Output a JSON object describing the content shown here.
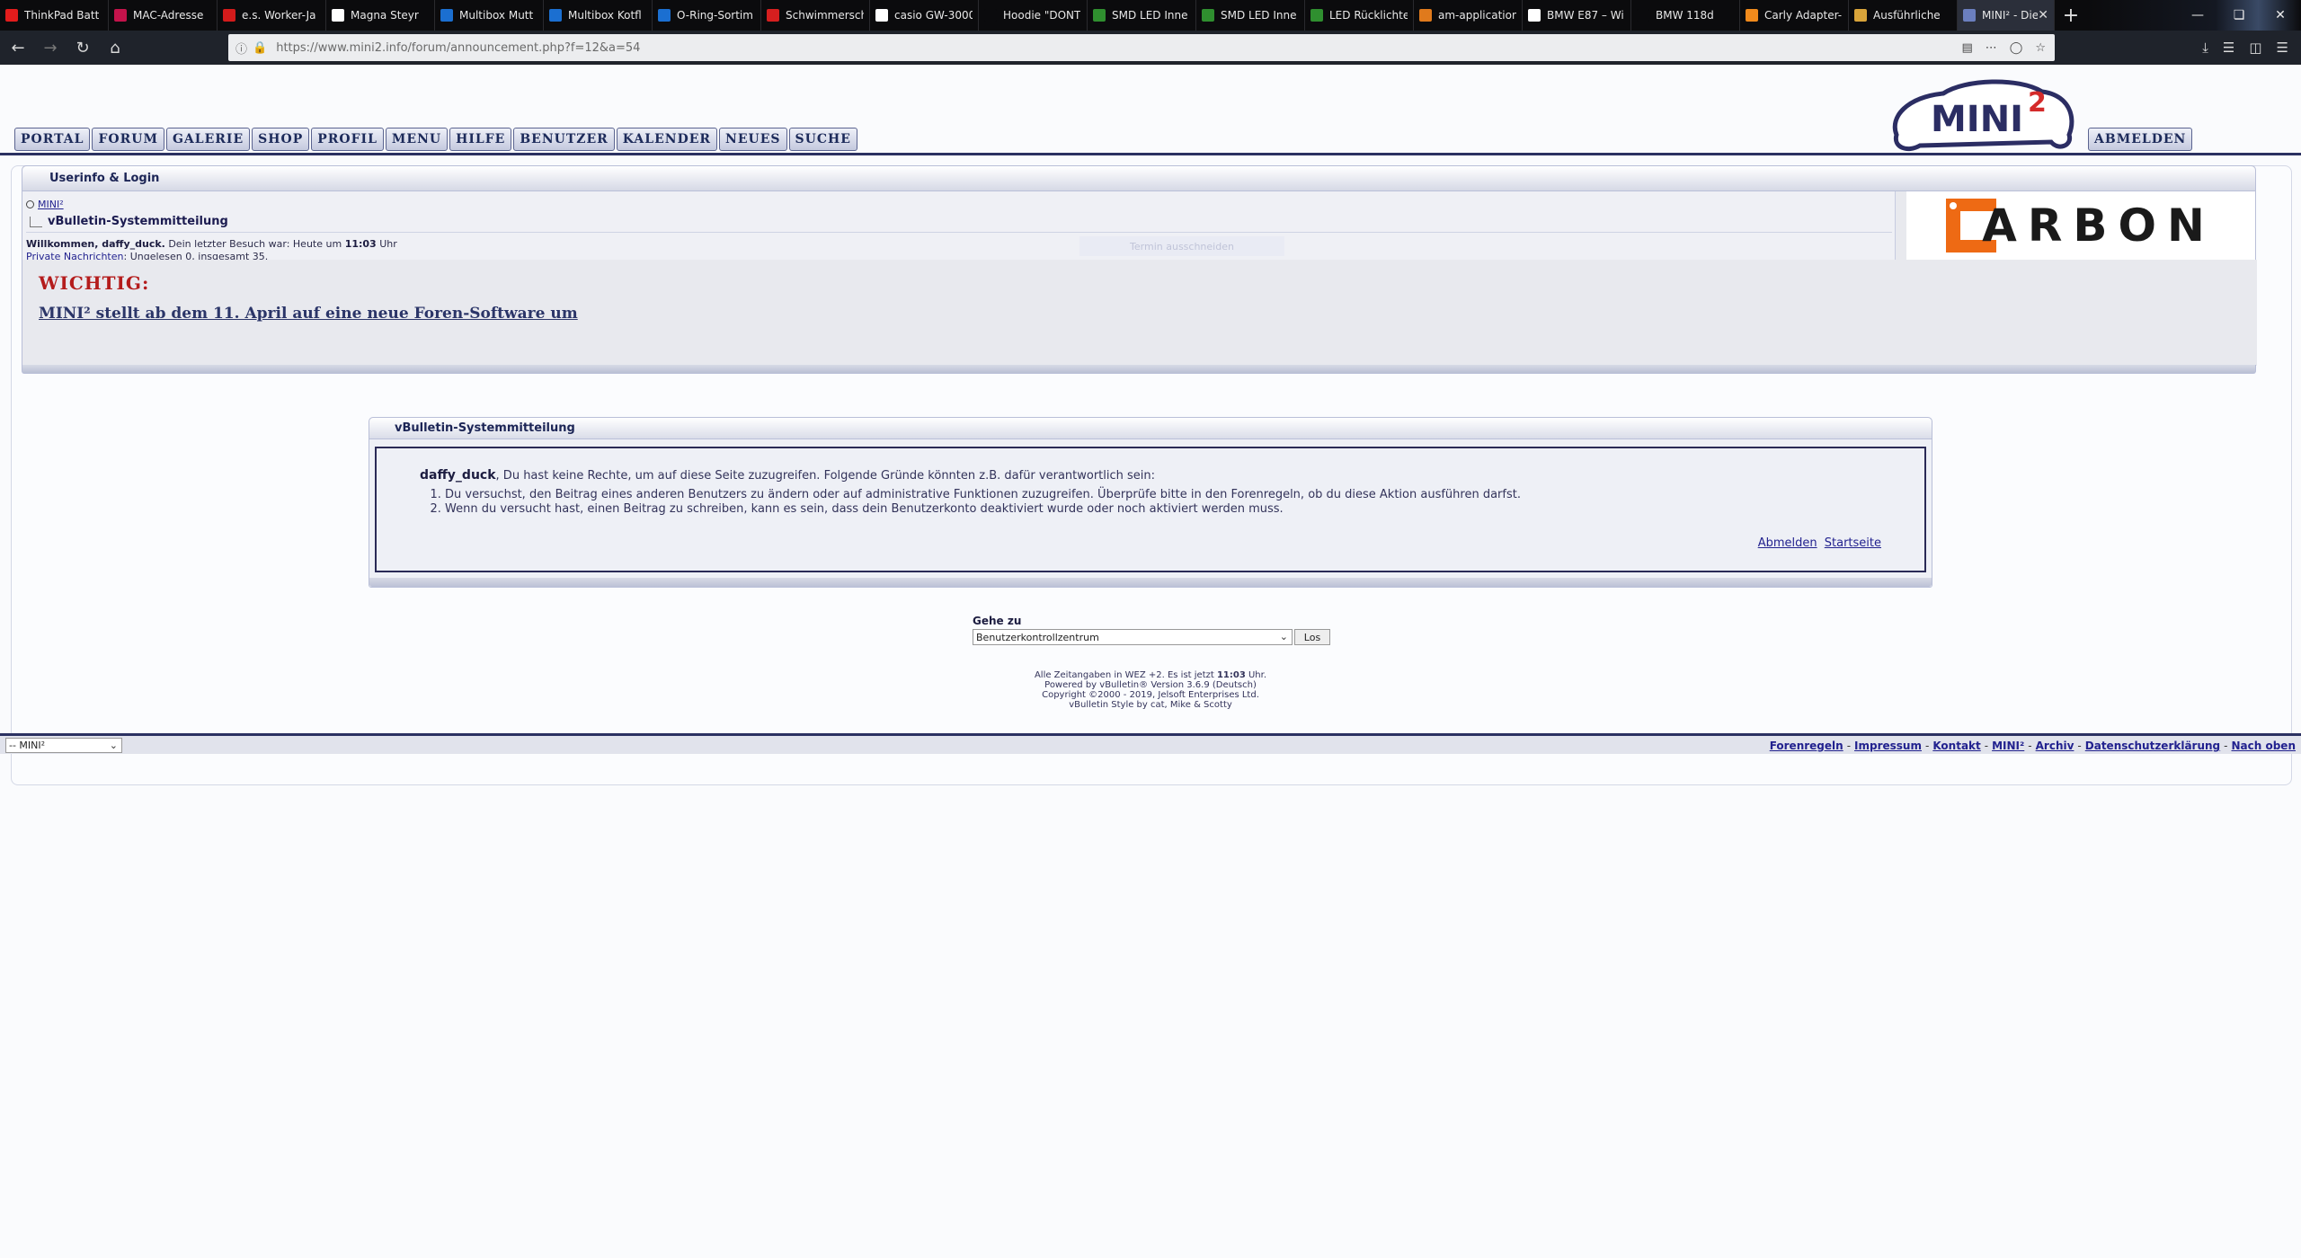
{
  "browser": {
    "tabs": [
      {
        "label": "ThinkPad Batt",
        "icon": "lenovo-icon",
        "color": "#e21c1c"
      },
      {
        "label": "MAC-Adresse",
        "icon": "heise-icon",
        "color": "#c4134b"
      },
      {
        "label": "e.s. Worker-Ja",
        "icon": "swiss-flag-icon",
        "color": "#d31b1b"
      },
      {
        "label": "Magna Steyr",
        "icon": "magna-icon",
        "color": "#ffffff"
      },
      {
        "label": "Multibox Mutt",
        "icon": "multibox-icon",
        "color": "#1b6fd1"
      },
      {
        "label": "Multibox Kotfl",
        "icon": "multibox-icon",
        "color": "#1b6fd1"
      },
      {
        "label": "O-Ring-Sortim",
        "icon": "multibox-icon",
        "color": "#1b6fd1"
      },
      {
        "label": "Schwimmersch",
        "icon": "red-square-icon",
        "color": "#d61f1f"
      },
      {
        "label": "casio GW-3000",
        "icon": "google-icon",
        "color": "#ffffff"
      },
      {
        "label": "Hoodie \"DONT",
        "icon": "blank-icon",
        "color": "#0b0b0d"
      },
      {
        "label": "SMD LED Inne",
        "icon": "leaf-icon",
        "color": "#2f8f2f"
      },
      {
        "label": "SMD LED Inne",
        "icon": "leaf-icon",
        "color": "#2f8f2f"
      },
      {
        "label": "LED Rücklichte",
        "icon": "leaf-icon",
        "color": "#2f8f2f"
      },
      {
        "label": "am-application",
        "icon": "orange-square-icon",
        "color": "#e07a1c"
      },
      {
        "label": "BMW E87 – Wi",
        "icon": "wikipedia-icon",
        "color": "#ffffff"
      },
      {
        "label": "BMW 118d",
        "icon": "blank-icon",
        "color": "#0b0b0d"
      },
      {
        "label": "Carly Adapter-",
        "icon": "carly-icon",
        "color": "#f08a1c"
      },
      {
        "label": "Ausführliche",
        "icon": "orange-square-icon",
        "color": "#d9a43a"
      },
      {
        "label": "MINI² - Die",
        "icon": "mini-icon",
        "color": "#6b7fbf",
        "active": true
      }
    ],
    "url": "https://www.mini2.info/forum/announcement.php?f=12&a=54"
  },
  "nav": {
    "items": [
      "Portal",
      "Forum",
      "Galerie",
      "Shop",
      "Profil",
      "Menu",
      "Hilfe",
      "Benutzer",
      "Kalender",
      "Neues",
      "Suche"
    ],
    "logout": "Abmelden",
    "logo_text": "MINI",
    "logo_sup": "2"
  },
  "userinfo": {
    "header": "Userinfo & Login",
    "breadcrumb_root": "MINI²",
    "breadcrumb_current": "vBulletin-Systemmitteilung",
    "welcome_bold": "Willkommen, daffy_duck.",
    "welcome_text": " Dein letzter Besuch war: Heute um ",
    "last_visit_time": "11:03",
    "welcome_suffix": " Uhr",
    "pm_link": "Private Nachrichten",
    "pm_text": ": Ungelesen 0, insgesamt 35.",
    "ghost_button": "Termin ausschneiden",
    "ad_text": "ARBON"
  },
  "notice": {
    "title": "WICHTIG:",
    "link": "MINI² stellt ab dem 11. April auf eine neue Foren-Software um"
  },
  "system_message": {
    "header": "vBulletin-Systemmitteilung",
    "user": "daffy_duck",
    "intro": ", Du hast keine Rechte, um auf diese Seite zuzugreifen. Folgende Gründe könnten z.B. dafür verantwortlich sein:",
    "reasons": [
      "Du versuchst, den Beitrag eines anderen Benutzers zu ändern oder auf administrative Funktionen zuzugreifen. Überprüfe bitte in den Forenregeln, ob du diese Aktion ausführen darfst.",
      "Wenn du versucht hast, einen Beitrag zu schreiben, kann es sein, dass dein Benutzerkonto deaktiviert wurde oder noch aktiviert werden muss."
    ],
    "action_logout": "Abmelden",
    "action_home": "Startseite"
  },
  "goto": {
    "label": "Gehe zu",
    "selected": "Benutzerkontrollzentrum",
    "button": "Los"
  },
  "copyright": {
    "line1_pre": "Alle Zeitangaben in WEZ +2. Es ist jetzt ",
    "line1_time": "11:03",
    "line1_post": " Uhr.",
    "line2": "Powered by vBulletin® Version 3.6.9 (Deutsch)",
    "line3": "Copyright ©2000 - 2019, Jelsoft Enterprises Ltd.",
    "line4": "vBulletin Style by cat, Mike & Scotty"
  },
  "footer": {
    "style_select": "-- MINI²",
    "links": [
      "Forenregeln",
      "Impressum",
      "Kontakt",
      "MINI²",
      "Archiv",
      "Datenschutzerklärung",
      "Nach oben"
    ]
  }
}
